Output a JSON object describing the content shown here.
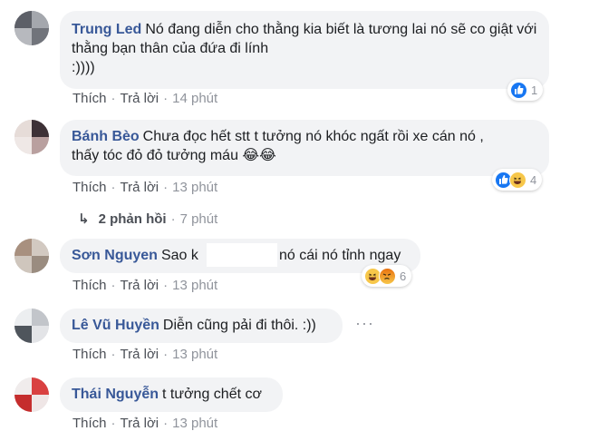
{
  "comments": [
    {
      "author": "Trung Led",
      "text": "Nó đang diễn cho thằng kia biết là tương lai nó sẽ co giật với thằng bạn thân của đứa đi lính",
      "text_line2": ":))))",
      "like": "Thích",
      "reply": "Trả lời",
      "time": "14 phút",
      "reaction_count": "1",
      "reactions": [
        "like-icon"
      ]
    },
    {
      "author": "Bánh Bèo",
      "text": "Chưa đọc hết stt t tưởng nó khóc ngất rồi xe cán nó ,",
      "text_line2": "thấy tóc đỏ đỏ tưởng máu 😂😂",
      "like": "Thích",
      "reply": "Trả lời",
      "time": "13 phút",
      "reaction_count": "4",
      "reactions": [
        "like-icon",
        "haha-icon"
      ]
    },
    {
      "author": "Sơn Nguyen",
      "text": "Sao k",
      "text_tail": "nó cái nó tỉnh ngay",
      "like": "Thích",
      "reply": "Trả lời",
      "time": "13 phút",
      "reaction_count": "6",
      "reactions": [
        "haha-icon",
        "angry-icon"
      ]
    },
    {
      "author": "Lê Vũ Huyền",
      "text": "Diễn cũng pải đi thôi. :))",
      "like": "Thích",
      "reply": "Trả lời",
      "time": "13 phút",
      "more": "···"
    },
    {
      "author": "Thái Nguyễn",
      "text": "t tưởng chết cơ",
      "like": "Thích",
      "reply": "Trả lời",
      "time": "13 phút"
    }
  ],
  "replies_link": {
    "label": "2 phản hồi",
    "time": "7 phút",
    "arrow": "↳"
  },
  "colors": {
    "author": "#385898",
    "bubble": "#f2f3f5",
    "like_blue": "#1877f2",
    "haha_yellow": "#f7c74a",
    "angry_red": "#e9710f"
  }
}
